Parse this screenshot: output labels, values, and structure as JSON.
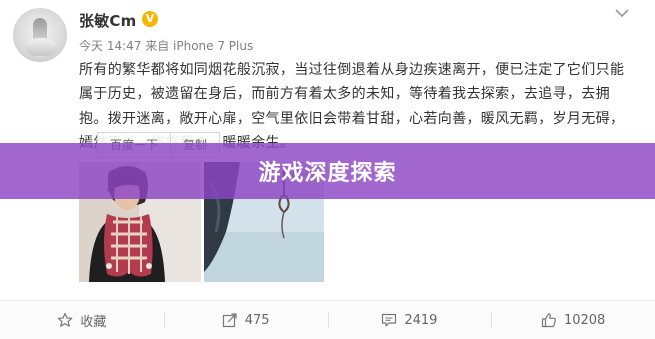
{
  "post": {
    "author": "张敏Cm",
    "verified_badge": "V",
    "meta": "今天 14:47 来自 iPhone 7 Plus",
    "text": "所有的繁华都将如同烟花般沉寂，当过往倒退着从身边疾速离开，便已注定了它们只能属于历史，被遗留在身后，而前方有着太多的未知，等待着我去探索，去追寻，去拥抱。拨开迷离，敞开心扉，空气里依旧会带着甘甜，心若向善，暖风无羁，岁月无碍，嫣然无恙。悠悠我心，暖暖余生。",
    "image_lookup": {
      "baidu_label": "百度一下",
      "copy_label": "复制"
    }
  },
  "banner": {
    "title": "游戏深度探索",
    "color": "#8c46c4"
  },
  "actions": [
    {
      "icon": "star-icon",
      "label": "收藏"
    },
    {
      "icon": "share-icon",
      "label": "475"
    },
    {
      "icon": "comment-icon",
      "label": "2419"
    },
    {
      "icon": "like-icon",
      "label": "10208"
    }
  ],
  "colors": {
    "verified": "#f7b500",
    "text": "#333333",
    "meta": "#808080"
  }
}
